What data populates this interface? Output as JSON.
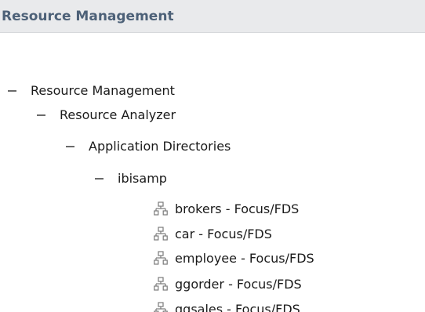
{
  "panel": {
    "title": "Resource Management"
  },
  "tree": {
    "root": {
      "label": "Resource Management",
      "expanded": true
    },
    "analyzer": {
      "label": "Resource Analyzer",
      "expanded": true
    },
    "app_dirs": {
      "label": "Application Directories",
      "expanded": true
    },
    "ibisamp": {
      "label": "ibisamp",
      "expanded": true
    },
    "leaves": [
      {
        "label": "brokers - Focus/FDS",
        "icon": "hierarchy-icon"
      },
      {
        "label": "car - Focus/FDS",
        "icon": "hierarchy-icon"
      },
      {
        "label": "employee - Focus/FDS",
        "icon": "hierarchy-icon"
      },
      {
        "label": "ggorder - Focus/FDS",
        "icon": "hierarchy-icon"
      },
      {
        "label": "ggsales - Focus/FDS",
        "icon": "hierarchy-icon"
      }
    ]
  }
}
